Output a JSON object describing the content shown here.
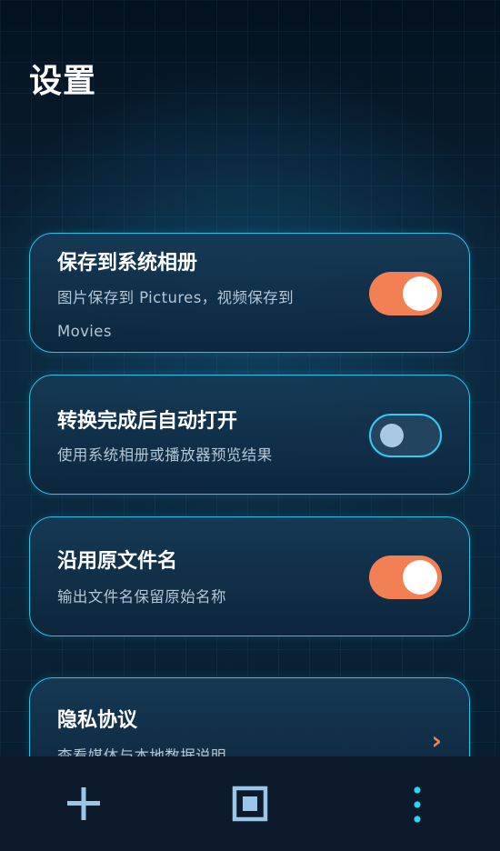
{
  "header": {
    "title": "设置"
  },
  "settings": [
    {
      "title": "保存到系统相册",
      "desc": "图片保存到 Pictures，视频保存到 Movies",
      "state": "on"
    },
    {
      "title": "转换完成后自动打开",
      "desc": "使用系统相册或播放器预览结果",
      "state": "off"
    },
    {
      "title": "沿用原文件名",
      "desc": "输出文件名保留原始名称",
      "state": "on"
    },
    {
      "title": "隐私协议",
      "desc": "查看媒体与本地数据说明",
      "chevron": "›"
    }
  ],
  "bottom_nav": {
    "add_icon": "plus-icon",
    "stop_icon": "stop-square-icon",
    "more_icon": "vertical-dots-icon"
  },
  "colors": {
    "accent_orange": "#f37f55",
    "accent_cyan": "#27c3e8",
    "toggle_off_knob": "#a8c8e6"
  }
}
